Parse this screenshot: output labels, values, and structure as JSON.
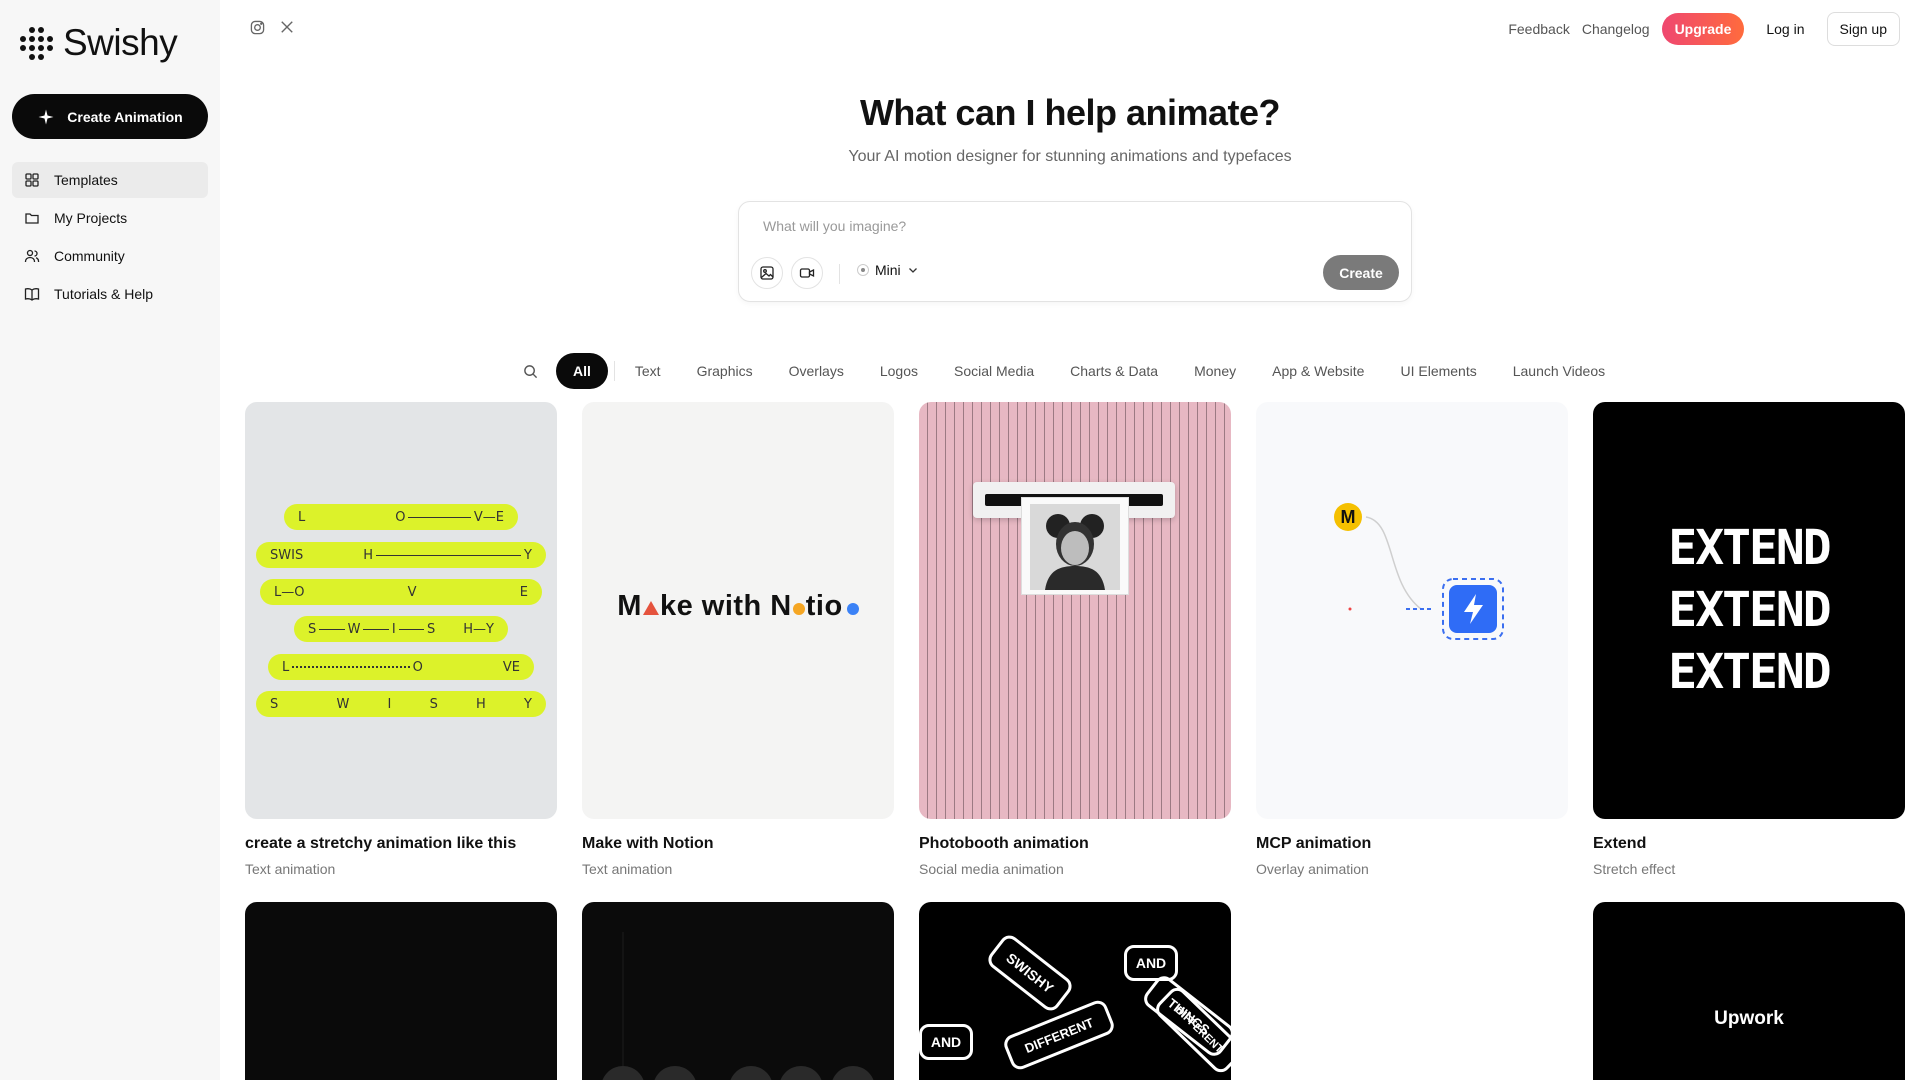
{
  "brand": {
    "name": "Swishy"
  },
  "sidebar": {
    "create_label": "Create Animation",
    "items": [
      {
        "label": "Templates",
        "icon": "grid-icon"
      },
      {
        "label": "My Projects",
        "icon": "folder-icon"
      },
      {
        "label": "Community",
        "icon": "users-icon"
      },
      {
        "label": "Tutorials & Help",
        "icon": "book-icon"
      }
    ]
  },
  "topbar": {
    "social": [
      "instagram-icon",
      "x-icon"
    ],
    "feedback": "Feedback",
    "changelog": "Changelog",
    "upgrade": "Upgrade",
    "login": "Log in",
    "signup": "Sign up"
  },
  "hero": {
    "title": "What can I help animate?",
    "subtitle": "Your AI motion designer for stunning animations and typefaces"
  },
  "prompt": {
    "placeholder": "What will you imagine?",
    "model": "Mini",
    "create": "Create"
  },
  "filters": [
    "All",
    "Text",
    "Graphics",
    "Overlays",
    "Logos",
    "Social Media",
    "Charts & Data",
    "Money",
    "App & Website",
    "UI Elements",
    "Launch Videos"
  ],
  "cards": [
    {
      "title": "create a stretchy animation like this",
      "subtitle": "Text animation"
    },
    {
      "title": "Make with Notion",
      "subtitle": "Text animation"
    },
    {
      "title": "Photobooth animation",
      "subtitle": "Social media animation"
    },
    {
      "title": "MCP animation",
      "subtitle": "Overlay animation"
    },
    {
      "title": "Extend",
      "subtitle": "Stretch effect"
    }
  ],
  "stretchy": {
    "rows": [
      [
        "L",
        "O",
        "V—E"
      ],
      [
        "S",
        "W",
        "I",
        "S",
        "H",
        "Y"
      ],
      [
        "L—O",
        "V",
        "E"
      ],
      [
        "S",
        "W",
        "I",
        "S",
        "H—Y"
      ],
      [
        "L",
        "O",
        "V",
        "E"
      ],
      [
        "S",
        "W",
        "I",
        "S",
        "H",
        "Y"
      ]
    ]
  },
  "notion": {
    "before": "M",
    "mid": "ke with N",
    "after": "tio"
  },
  "mcp": {
    "badge": "M"
  },
  "extend": {
    "words": [
      "EXTEND",
      "EXTEND",
      "EXTEND"
    ]
  },
  "row2": {
    "stickers": [
      "SWISHY",
      "AND",
      "DIFFERENT",
      "AND",
      "THINGS",
      "DIFFERENT"
    ],
    "upwork": "Upwork"
  },
  "colors": {
    "accent": "#dcf22a",
    "upgrade_start": "#ef4770",
    "upgrade_end": "#ff6b3d",
    "photobooth_bg": "#e7b8c3"
  }
}
